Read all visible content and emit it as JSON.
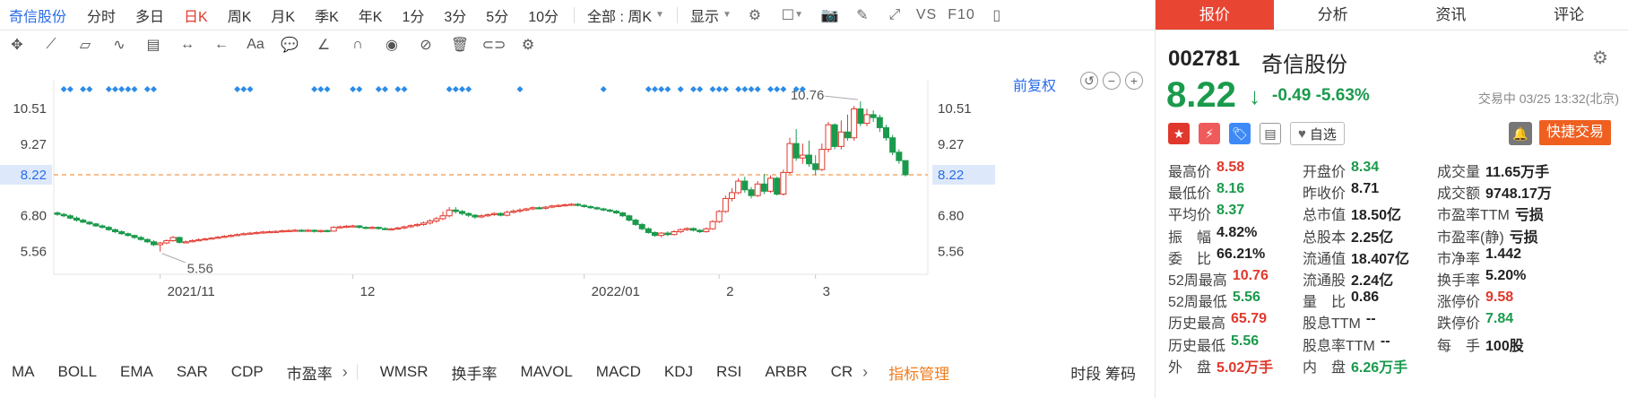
{
  "toolbar": {
    "stock_name": "奇信股份",
    "periods": [
      "分时",
      "多日",
      "日K",
      "周K",
      "月K",
      "季K",
      "年K",
      "1分",
      "3分",
      "5分",
      "10分"
    ],
    "active_period": "日K",
    "range_select": "全部 : 周K",
    "display_label": "显示",
    "vs_label": "VS",
    "f10_label": "F10"
  },
  "chart": {
    "restore_label": "前复权",
    "price_ticks": [
      "10.51",
      "9.27",
      "8.22",
      "6.80",
      "5.56"
    ],
    "current_price_label": "8.22",
    "x_labels": [
      "2021/11",
      "12",
      "2022/01",
      "2",
      "3"
    ],
    "high_annotation": "10.76",
    "low_annotation": "5.56",
    "colors": {
      "up": "#e0382c",
      "down": "#1a9a4c",
      "accent": "#2b6ce8",
      "dashed_line": "#ef7d1f",
      "event_dot": "#2b8ce8"
    }
  },
  "chart_data": {
    "type": "candlestick",
    "ylim": [
      4.9,
      11.6
    ],
    "current_price": 8.22,
    "x_ticks": [
      "2021/11",
      "12",
      "2022/01",
      "2",
      "3"
    ],
    "candles": [
      [
        6.9,
        6.85,
        6.95,
        6.8
      ],
      [
        6.85,
        6.8,
        6.9,
        6.75
      ],
      [
        6.8,
        6.72,
        6.85,
        6.68
      ],
      [
        6.72,
        6.65,
        6.78,
        6.6
      ],
      [
        6.65,
        6.58,
        6.7,
        6.55
      ],
      [
        6.58,
        6.52,
        6.62,
        6.48
      ],
      [
        6.52,
        6.45,
        6.55,
        6.42
      ],
      [
        6.45,
        6.4,
        6.5,
        6.36
      ],
      [
        6.4,
        6.32,
        6.45,
        6.28
      ],
      [
        6.32,
        6.25,
        6.36,
        6.2
      ],
      [
        6.25,
        6.18,
        6.3,
        6.14
      ],
      [
        6.18,
        6.12,
        6.22,
        6.08
      ],
      [
        6.12,
        6.05,
        6.15,
        6.0
      ],
      [
        6.05,
        5.98,
        6.1,
        5.94
      ],
      [
        5.98,
        5.9,
        6.02,
        5.86
      ],
      [
        5.9,
        5.8,
        5.95,
        5.75
      ],
      [
        5.8,
        5.86,
        5.9,
        5.56
      ],
      [
        5.86,
        5.94,
        5.98,
        5.82
      ],
      [
        5.94,
        6.05,
        6.1,
        5.9
      ],
      [
        6.05,
        5.88,
        6.08,
        5.84
      ],
      [
        5.88,
        5.9,
        5.94,
        5.85
      ],
      [
        5.9,
        5.94,
        5.98,
        5.88
      ],
      [
        5.94,
        5.97,
        6.02,
        5.92
      ],
      [
        5.97,
        6.0,
        6.04,
        5.95
      ],
      [
        6.0,
        6.03,
        6.06,
        5.98
      ],
      [
        6.03,
        6.06,
        6.1,
        6.0
      ],
      [
        6.06,
        6.09,
        6.13,
        6.04
      ],
      [
        6.09,
        6.12,
        6.16,
        6.06
      ],
      [
        6.12,
        6.15,
        6.19,
        6.1
      ],
      [
        6.15,
        6.18,
        6.22,
        6.12
      ],
      [
        6.18,
        6.2,
        6.24,
        6.14
      ],
      [
        6.2,
        6.22,
        6.26,
        6.16
      ],
      [
        6.22,
        6.24,
        6.28,
        6.18
      ],
      [
        6.24,
        6.25,
        6.29,
        6.2
      ],
      [
        6.25,
        6.26,
        6.3,
        6.21
      ],
      [
        6.26,
        6.28,
        6.32,
        6.22
      ],
      [
        6.28,
        6.29,
        6.33,
        6.24
      ],
      [
        6.29,
        6.3,
        6.34,
        6.25
      ],
      [
        6.3,
        6.28,
        6.34,
        6.24
      ],
      [
        6.28,
        6.3,
        6.34,
        6.24
      ],
      [
        6.3,
        6.26,
        6.33,
        6.22
      ],
      [
        6.26,
        6.29,
        6.32,
        6.22
      ],
      [
        6.29,
        6.27,
        6.32,
        6.23
      ],
      [
        6.27,
        6.4,
        6.44,
        6.25
      ],
      [
        6.4,
        6.42,
        6.46,
        6.36
      ],
      [
        6.42,
        6.44,
        6.48,
        6.38
      ],
      [
        6.44,
        6.45,
        6.49,
        6.4
      ],
      [
        6.45,
        6.4,
        6.48,
        6.36
      ],
      [
        6.4,
        6.38,
        6.44,
        6.34
      ],
      [
        6.38,
        6.4,
        6.44,
        6.34
      ],
      [
        6.4,
        6.36,
        6.43,
        6.32
      ],
      [
        6.36,
        6.33,
        6.4,
        6.3
      ],
      [
        6.33,
        6.35,
        6.38,
        6.3
      ],
      [
        6.35,
        6.38,
        6.42,
        6.32
      ],
      [
        6.38,
        6.42,
        6.46,
        6.34
      ],
      [
        6.42,
        6.46,
        6.5,
        6.38
      ],
      [
        6.46,
        6.5,
        6.54,
        6.42
      ],
      [
        6.5,
        6.55,
        6.6,
        6.46
      ],
      [
        6.55,
        6.62,
        6.68,
        6.5
      ],
      [
        6.62,
        6.7,
        6.76,
        6.56
      ],
      [
        6.7,
        6.8,
        6.95,
        6.65
      ],
      [
        6.8,
        7.0,
        7.1,
        6.75
      ],
      [
        7.0,
        6.95,
        7.1,
        6.88
      ],
      [
        6.95,
        6.88,
        7.0,
        6.82
      ],
      [
        6.88,
        6.82,
        6.92,
        6.76
      ],
      [
        6.82,
        6.76,
        6.86,
        6.7
      ],
      [
        6.76,
        6.8,
        6.85,
        6.72
      ],
      [
        6.8,
        6.84,
        6.88,
        6.76
      ],
      [
        6.84,
        6.88,
        6.92,
        6.8
      ],
      [
        6.88,
        6.82,
        6.92,
        6.78
      ],
      [
        6.82,
        6.92,
        6.98,
        6.78
      ],
      [
        6.92,
        6.96,
        7.02,
        6.88
      ],
      [
        6.96,
        7.0,
        7.06,
        6.9
      ],
      [
        7.0,
        7.04,
        7.08,
        6.96
      ],
      [
        7.04,
        7.08,
        7.12,
        7.0
      ],
      [
        7.08,
        7.06,
        7.12,
        7.02
      ],
      [
        7.06,
        7.1,
        7.14,
        7.02
      ],
      [
        7.1,
        7.14,
        7.18,
        7.06
      ],
      [
        7.14,
        7.16,
        7.2,
        7.1
      ],
      [
        7.16,
        7.18,
        7.22,
        7.12
      ],
      [
        7.18,
        7.2,
        7.24,
        7.14
      ],
      [
        7.2,
        7.16,
        7.24,
        7.12
      ],
      [
        7.16,
        7.12,
        7.2,
        7.08
      ],
      [
        7.12,
        7.08,
        7.16,
        7.04
      ],
      [
        7.08,
        7.04,
        7.12,
        7.0
      ],
      [
        7.04,
        7.0,
        7.08,
        6.96
      ],
      [
        7.0,
        6.96,
        7.04,
        6.92
      ],
      [
        6.96,
        6.9,
        7.0,
        6.86
      ],
      [
        6.9,
        6.8,
        6.94,
        6.76
      ],
      [
        6.8,
        6.65,
        6.84,
        6.6
      ],
      [
        6.65,
        6.5,
        6.7,
        6.45
      ],
      [
        6.5,
        6.35,
        6.55,
        6.3
      ],
      [
        6.35,
        6.22,
        6.4,
        6.18
      ],
      [
        6.22,
        6.12,
        6.26,
        6.08
      ],
      [
        6.12,
        6.2,
        6.24,
        6.06
      ],
      [
        6.2,
        6.15,
        6.26,
        6.1
      ],
      [
        6.15,
        6.25,
        6.3,
        6.12
      ],
      [
        6.25,
        6.32,
        6.36,
        6.2
      ],
      [
        6.32,
        6.36,
        6.4,
        6.28
      ],
      [
        6.36,
        6.3,
        6.4,
        6.26
      ],
      [
        6.3,
        6.25,
        6.34,
        6.2
      ],
      [
        6.25,
        6.35,
        6.4,
        6.22
      ],
      [
        6.35,
        6.6,
        6.65,
        6.32
      ],
      [
        6.6,
        6.95,
        7.0,
        6.55
      ],
      [
        6.95,
        7.4,
        7.5,
        6.9
      ],
      [
        7.4,
        7.6,
        7.75,
        7.3
      ],
      [
        7.6,
        8.0,
        8.1,
        7.55
      ],
      [
        8.0,
        7.7,
        8.15,
        7.6
      ],
      [
        7.7,
        7.5,
        7.8,
        7.4
      ],
      [
        7.5,
        7.9,
        8.0,
        7.45
      ],
      [
        7.9,
        7.65,
        8.25,
        7.55
      ],
      [
        7.65,
        8.1,
        8.2,
        7.6
      ],
      [
        8.1,
        7.55,
        8.15,
        7.5
      ],
      [
        7.55,
        8.3,
        8.4,
        7.5
      ],
      [
        8.3,
        9.3,
        9.5,
        8.25
      ],
      [
        9.3,
        8.8,
        9.8,
        8.7
      ],
      [
        8.8,
        8.9,
        9.3,
        8.6
      ],
      [
        8.9,
        8.6,
        9.4,
        8.5
      ],
      [
        8.6,
        8.4,
        8.9,
        8.2
      ],
      [
        8.4,
        9.1,
        9.3,
        8.35
      ],
      [
        9.1,
        9.95,
        10.05,
        9.0
      ],
      [
        9.95,
        9.2,
        10.0,
        9.1
      ],
      [
        9.2,
        9.7,
        10.1,
        9.1
      ],
      [
        9.7,
        9.5,
        10.3,
        9.4
      ],
      [
        9.5,
        10.5,
        10.6,
        9.4
      ],
      [
        10.5,
        10.0,
        10.76,
        9.9
      ],
      [
        10.0,
        10.3,
        10.5,
        9.9
      ],
      [
        10.3,
        10.2,
        10.45,
        10.05
      ],
      [
        10.2,
        9.85,
        10.3,
        9.7
      ],
      [
        9.85,
        9.5,
        9.95,
        9.4
      ],
      [
        9.5,
        9.0,
        9.6,
        8.9
      ],
      [
        9.0,
        8.71,
        9.1,
        8.6
      ],
      [
        8.71,
        8.22,
        8.58,
        8.16
      ]
    ]
  },
  "panel": {
    "tabs": [
      "报价",
      "分析",
      "资讯",
      "评论"
    ],
    "active_tab": "报价",
    "code": "002781",
    "name": "奇信股份",
    "price": "8.22",
    "change": "-0.49",
    "change_pct": "-5.63%",
    "time": "交易中 03/25 13:32(北京)",
    "watch_label": "自选",
    "quick_trade_label": "快捷交易",
    "stats": [
      [
        [
          "最高价",
          "8.58",
          "red"
        ],
        [
          "开盘价",
          "8.34",
          "green"
        ],
        [
          "成交量",
          "11.65万手",
          ""
        ]
      ],
      [
        [
          "最低价",
          "8.16",
          "green"
        ],
        [
          "昨收价",
          "8.71",
          ""
        ],
        [
          "成交额",
          "9748.17万",
          ""
        ]
      ],
      [
        [
          "平均价",
          "8.37",
          "green"
        ],
        [
          "总市值",
          "18.50亿",
          ""
        ],
        [
          "市盈率TTM",
          "亏损",
          ""
        ]
      ],
      [
        [
          "振　幅",
          "4.82%",
          ""
        ],
        [
          "总股本",
          "2.25亿",
          ""
        ],
        [
          "市盈率(静)",
          "亏损",
          ""
        ]
      ],
      [
        [
          "委　比",
          "66.21%",
          ""
        ],
        [
          "流通值",
          "18.407亿",
          ""
        ],
        [
          "市净率",
          "1.442",
          ""
        ]
      ],
      [
        [
          "52周最高",
          "10.76",
          "red"
        ],
        [
          "流通股",
          "2.24亿",
          ""
        ],
        [
          "换手率",
          "5.20%",
          ""
        ]
      ],
      [
        [
          "52周最低",
          "5.56",
          "green"
        ],
        [
          "量　比",
          "0.86",
          ""
        ],
        [
          "涨停价",
          "9.58",
          "red"
        ]
      ],
      [
        [
          "历史最高",
          "65.79",
          "red"
        ],
        [
          "股息TTM",
          "--",
          ""
        ],
        [
          "跌停价",
          "7.84",
          "green"
        ]
      ],
      [
        [
          "历史最低",
          "5.56",
          "green"
        ],
        [
          "股息率TTM",
          "--",
          ""
        ],
        [
          "每　手",
          "100股",
          ""
        ]
      ],
      [
        [
          "外　盘",
          "5.02万手",
          "red"
        ],
        [
          "内　盘",
          "6.26万手",
          "green"
        ],
        [
          "",
          "",
          ""
        ]
      ]
    ]
  },
  "indicators": {
    "items": [
      "MA",
      "BOLL",
      "EMA",
      "SAR",
      "CDP",
      "市盈率",
      "WMSR",
      "换手率",
      "MAVOL",
      "MACD",
      "KDJ",
      "RSI",
      "ARBR",
      "CR"
    ],
    "manager_label": "指标管理",
    "right_label": "时段 筹码"
  }
}
